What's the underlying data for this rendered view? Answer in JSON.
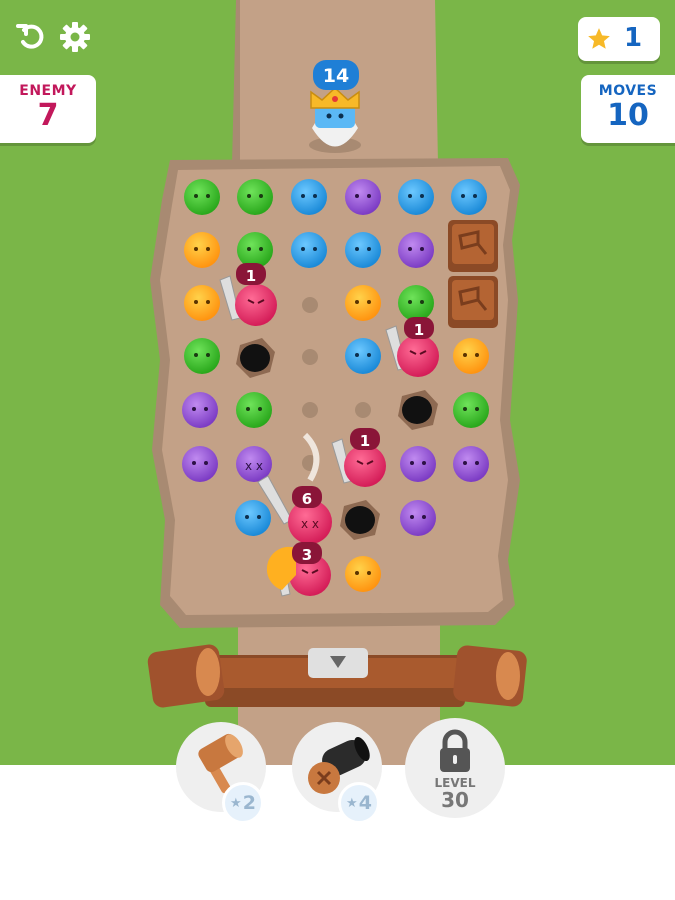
{
  "hud": {
    "enemy": {
      "label": "ENEMY",
      "value": "7"
    },
    "moves": {
      "label": "MOVES",
      "value": "10"
    },
    "stars": {
      "value": "1"
    },
    "restart_icon": "restart-icon",
    "settings_icon": "gear-icon"
  },
  "boss": {
    "health": "14"
  },
  "enemies": [
    {
      "number": "1"
    },
    {
      "number": "1"
    },
    {
      "number": "1"
    },
    {
      "number": "6"
    },
    {
      "number": "3"
    }
  ],
  "powerups": {
    "hammer": {
      "cost": "2",
      "icon": "hammer-icon"
    },
    "cannon": {
      "cost": "4",
      "icon": "cannon-icon"
    },
    "locked": {
      "label": "LEVEL",
      "value": "30",
      "icon": "lock-icon"
    }
  },
  "colors": {
    "grass": "#7ab648",
    "path": "#c3a187",
    "board": "#bf9f86",
    "green": "#43c232",
    "blue": "#2fa4ee",
    "purple": "#9b59dc",
    "orange": "#ffa41a",
    "enemy": "#e8336f",
    "wood": "#a0522d",
    "panel_text_enemy": "#c2185b",
    "panel_text_moves": "#1565c0"
  }
}
